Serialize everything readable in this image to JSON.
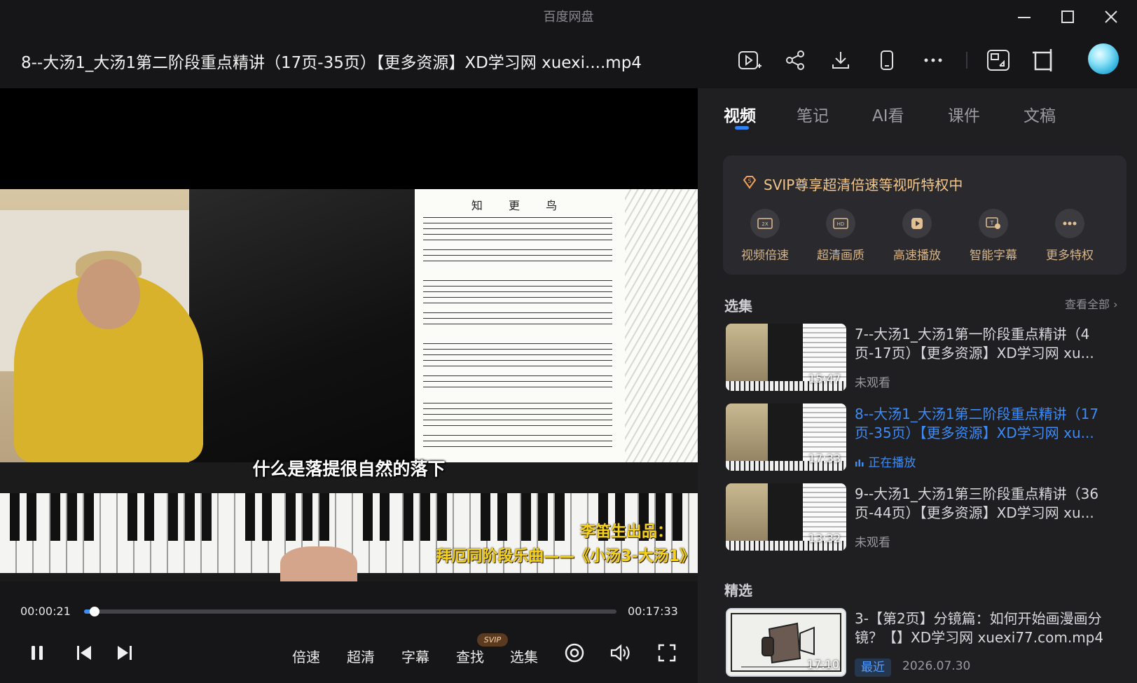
{
  "app": {
    "name": "百度网盘"
  },
  "header": {
    "file_title": "8--大汤1_大汤1第二阶段重点精讲（17页-35页）【更多资源】XD学习网 xuexi....mp4"
  },
  "video": {
    "sheet_title": "知 更 鸟",
    "subtitle": "什么是落提很自然的落下",
    "credit_line1": "李笛生出品：",
    "credit_line2": "拜厄同阶段乐曲——《小汤3-大汤1》"
  },
  "controls": {
    "current_time": "00:00:21",
    "total_time": "00:17:33",
    "progress": 0.02,
    "speed": "倍速",
    "quality": "超清",
    "subtitle_btn": "字幕",
    "find": "查找",
    "svip_badge": "SVIP",
    "episodes": "选集"
  },
  "tabs": [
    "视频",
    "笔记",
    "AI看",
    "课件",
    "文稿"
  ],
  "svip_card": {
    "title": "SVIP尊享超清倍速等视听特权中",
    "features": [
      {
        "label": "视频倍速",
        "icon": "speed-2x-icon"
      },
      {
        "label": "超清画质",
        "icon": "hd-icon"
      },
      {
        "label": "高速播放",
        "icon": "fast-play-icon"
      },
      {
        "label": "智能字幕",
        "icon": "smart-subtitle-icon"
      },
      {
        "label": "更多特权",
        "icon": "more-icon"
      }
    ]
  },
  "episodes_section": {
    "title": "选集",
    "view_all": "查看全部",
    "items": [
      {
        "title": "7--大汤1_大汤1第一阶段重点精讲（4页-17页）【更多资源】XD学习网 xu...",
        "duration": "15:47",
        "status": "未观看"
      },
      {
        "title": "8--大汤1_大汤1第二阶段重点精讲（17页-35页）【更多资源】XD学习网 xu...",
        "duration": "17:33",
        "status": "正在播放"
      },
      {
        "title": "9--大汤1_大汤1第三阶段重点精讲（36页-44页）【更多资源】XD学习网 xu...",
        "duration": "13:32",
        "status": "未观看"
      }
    ]
  },
  "picks_section": {
    "title": "精选",
    "items": [
      {
        "title": "3-【第2页】分镜篇：如何开始画漫画分镜？【】XD学习网 xuexi77.com.mp4",
        "duration": "17:10",
        "tag": "最近",
        "date": "2026.07.30"
      }
    ]
  },
  "colors": {
    "accent": "#3d8cf5",
    "svip_gold": "#f2c58a",
    "bg": "#1a1a1c",
    "panel": "#1f1f22"
  }
}
